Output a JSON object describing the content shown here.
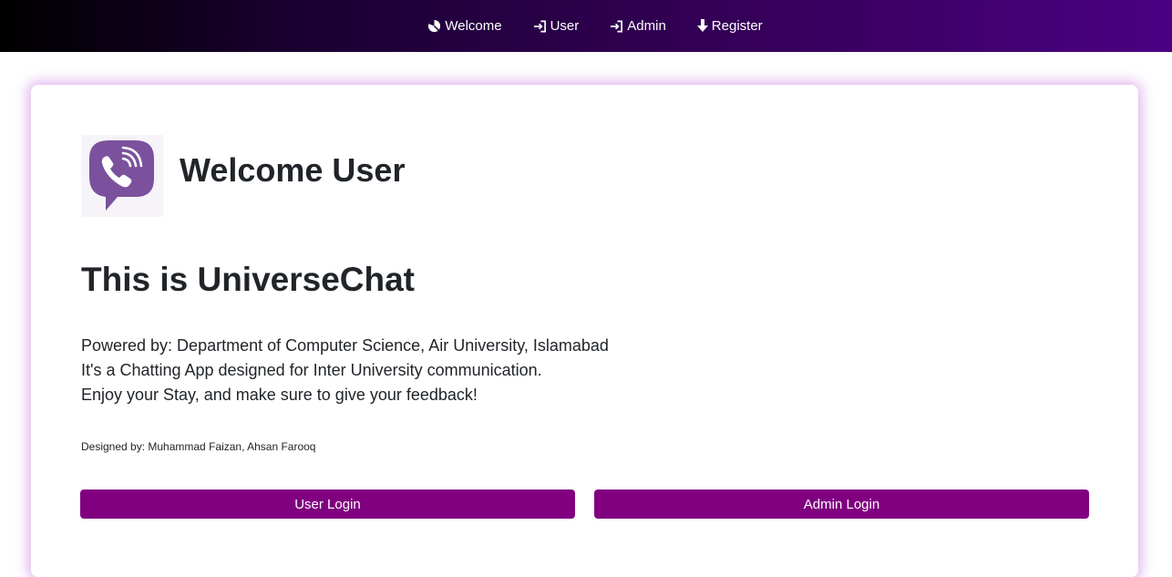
{
  "nav": {
    "items": [
      {
        "label": "Welcome",
        "icon": "pie-chart-icon"
      },
      {
        "label": "User",
        "icon": "sign-in-icon"
      },
      {
        "label": "Admin",
        "icon": "sign-in-icon"
      },
      {
        "label": "Register",
        "icon": "arrow-down-icon"
      }
    ]
  },
  "main": {
    "logo_icon": "viber-phone-bubble-icon",
    "welcome_heading": "Welcome User",
    "app_title": "This is UniverseChat",
    "description": [
      "Powered by: Department of Computer Science, Air University, Islamabad",
      "It's a Chatting App designed for Inter University communication.",
      "Enjoy your Stay, and make sure to give your feedback!"
    ],
    "credits": "Designed by: Muhammad Faizan, Ahsan Farooq",
    "user_login_label": "User Login",
    "admin_login_label": "Admin Login"
  },
  "colors": {
    "nav_gradient_start": "#000000",
    "nav_gradient_end": "#4b0082",
    "button": "#800080",
    "logo": "#7b519d",
    "card_glow": "#d6a0e6"
  }
}
